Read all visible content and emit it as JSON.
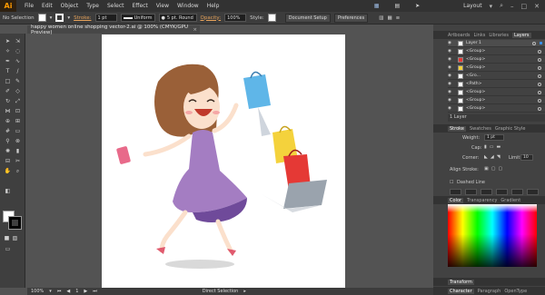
{
  "app": {
    "logo": "Ai"
  },
  "menu": [
    "File",
    "Edit",
    "Object",
    "Type",
    "Select",
    "Effect",
    "View",
    "Window",
    "Help"
  ],
  "workspace": "Layout",
  "control_bar": {
    "selection_label": "No Selection",
    "stroke_label": "Stroke:",
    "stroke_weight": "1 pt",
    "profile": "Uniform",
    "brush": "5 pt. Round",
    "opacity_label": "Opacity:",
    "opacity_value": "100%",
    "style_label": "Style:",
    "doc_setup": "Document Setup",
    "preferences": "Preferences"
  },
  "document_tab": {
    "title": "happy women online shopping vector-2.ai @ 100% (CMYK/GPU Preview)",
    "close": "×"
  },
  "panels": {
    "top_tabs": [
      "Artboards",
      "Links",
      "Libraries",
      "Layers"
    ],
    "active_tab": "Layers",
    "layers": [
      {
        "name": "Layer 1"
      },
      {
        "name": "<Group>"
      },
      {
        "name": "<Group>"
      },
      {
        "name": "<Group>"
      },
      {
        "name": "<Gro..."
      },
      {
        "name": "<Path>"
      },
      {
        "name": "<Group>"
      },
      {
        "name": "<Group>"
      },
      {
        "name": "<Group>"
      }
    ],
    "layer_count": "1 Layer",
    "stroke_tabs": [
      "Stroke",
      "Swatches",
      "Graphic Style"
    ],
    "stroke": {
      "weight_label": "Weight:",
      "weight_value": "1 pt",
      "cap_label": "Cap:",
      "corner_label": "Corner:",
      "limit_label": "Limit:",
      "limit_value": "10",
      "align_label": "Align Stroke:",
      "dashed_label": "Dashed Line",
      "dash_labels": [
        "dash",
        "gap",
        "dash",
        "gap",
        "dash",
        "gap"
      ]
    },
    "color_tabs": [
      "Color",
      "Transparency",
      "Gradient"
    ],
    "transform_label": "Transform",
    "character_tabs": [
      "Character",
      "Paragraph",
      "OpenType"
    ]
  },
  "status": {
    "zoom": "100%",
    "page": "1",
    "tool": "Direct Selection"
  }
}
